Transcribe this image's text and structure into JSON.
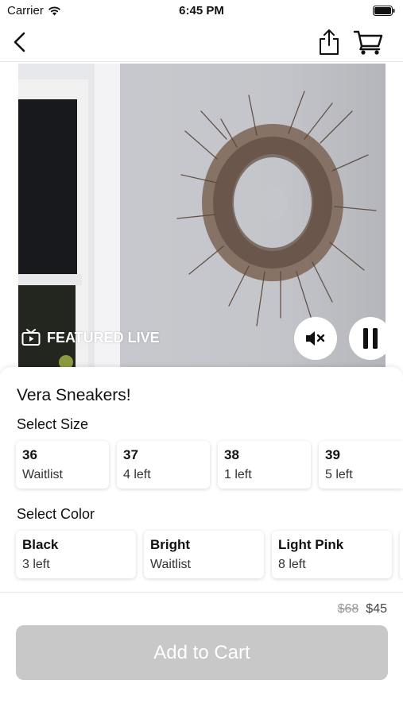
{
  "status_bar": {
    "carrier": "Carrier",
    "time": "6:45 PM"
  },
  "nav": {
    "back_icon": "chevron-left-icon",
    "share_icon": "share-icon",
    "cart_icon": "cart-icon"
  },
  "video": {
    "badge_label": "FEATURED LIVE",
    "badge_icon": "tv-play-icon",
    "mute_icon": "speaker-muted-icon",
    "pause_icon": "pause-icon"
  },
  "product": {
    "title": "Vera Sneakers!",
    "size_section_label": "Select Size",
    "sizes": [
      {
        "name": "36",
        "stock": "Waitlist"
      },
      {
        "name": "37",
        "stock": "4 left"
      },
      {
        "name": "38",
        "stock": "1 left"
      },
      {
        "name": "39",
        "stock": "5 left"
      }
    ],
    "color_section_label": "Select Color",
    "colors": [
      {
        "name": "Black",
        "stock": "3 left"
      },
      {
        "name": "Bright",
        "stock": "Waitlist"
      },
      {
        "name": "Light Pink",
        "stock": "8 left"
      }
    ],
    "original_price": "$68",
    "sale_price": "$45",
    "add_to_cart_label": "Add to Cart"
  },
  "colors": {
    "disabled_button": "#c8c8c8",
    "video_wall": "#c4c6cb"
  }
}
